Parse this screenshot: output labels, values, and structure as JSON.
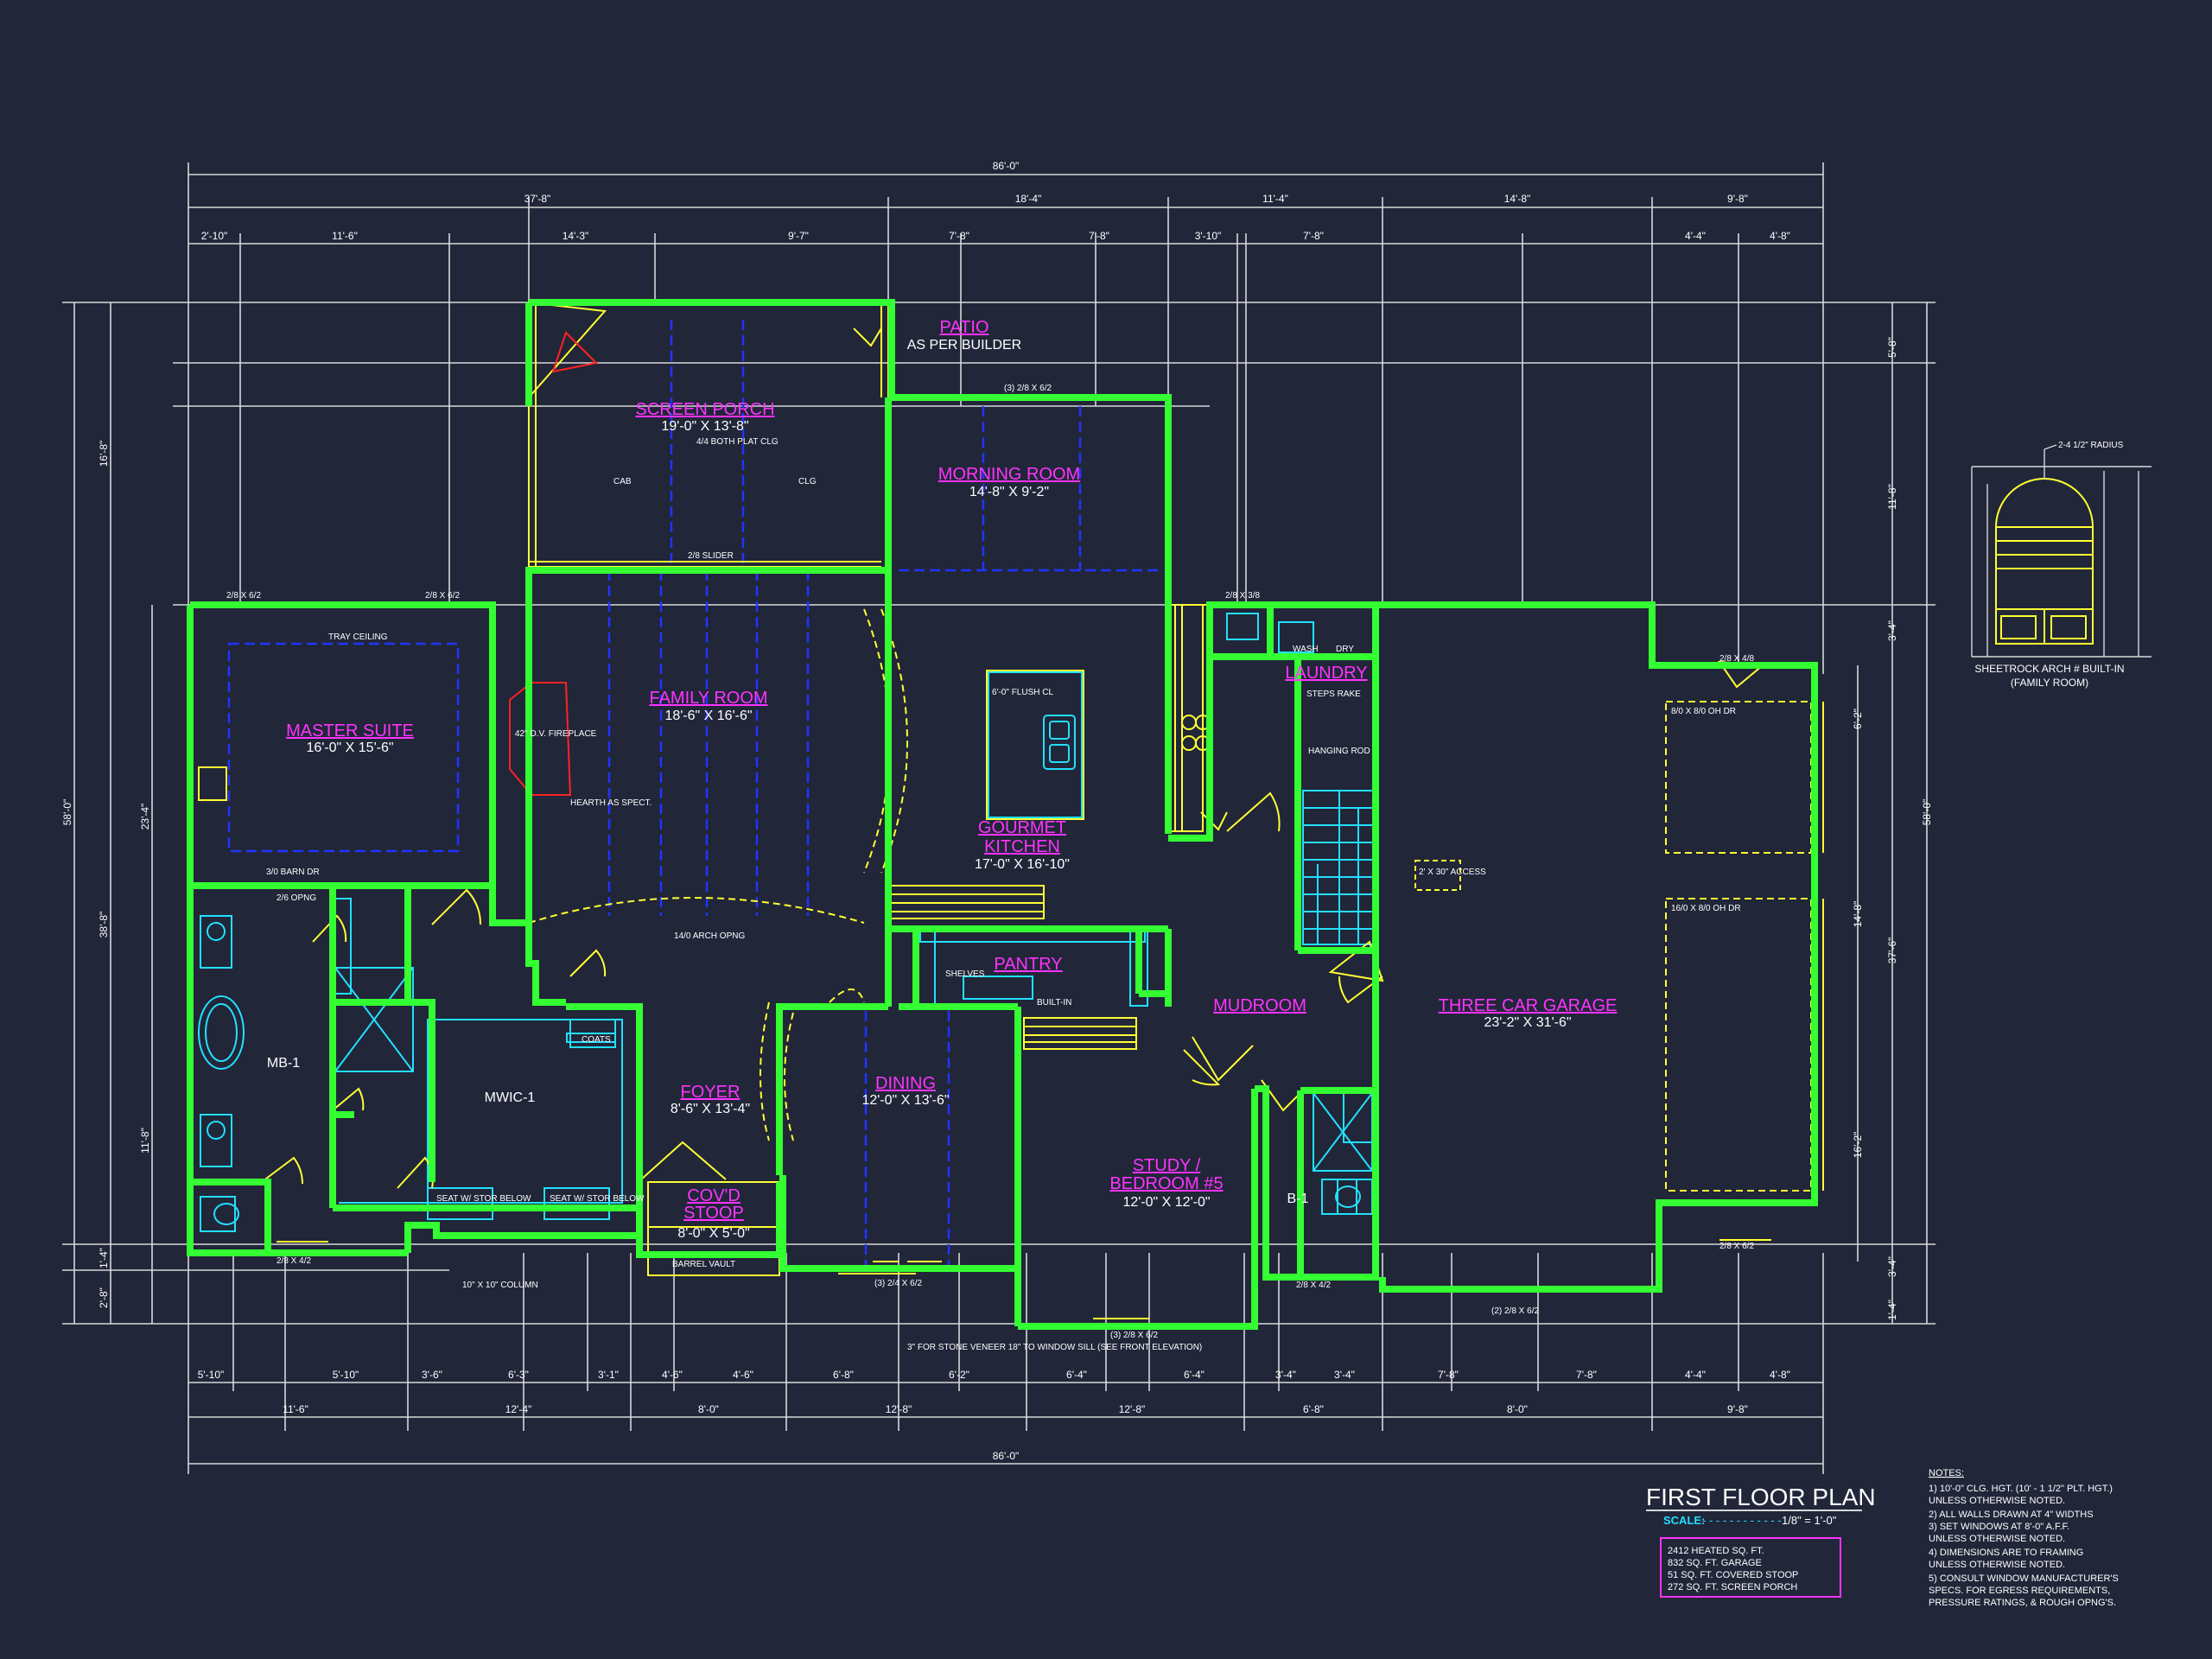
{
  "colors": {
    "background": "#212639",
    "wall": "#33ff33",
    "dimension": "#e8e8e8",
    "room_label": "#ff33ff",
    "fixture": "#ffff33",
    "beam": "#2233ff",
    "cabinet": "#22e0ff",
    "stair": "#22e0ff"
  },
  "rooms": [
    {
      "name": "PATIO",
      "size": "AS PER BUILDER"
    },
    {
      "name": "SCREEN PORCH",
      "size": "19'-0\" X 13'-8\""
    },
    {
      "name": "MORNING ROOM",
      "size": "14'-8\" X 9'-2\""
    },
    {
      "name": "MASTER SUITE",
      "size": "16'-0\" X 15'-6\""
    },
    {
      "name": "FAMILY ROOM",
      "size": "18'-6\" X 16'-6\""
    },
    {
      "name": "GOURMET",
      "size": "KITCHEN"
    },
    {
      "name": "LAUNDRY",
      "size": ""
    },
    {
      "name": "PANTRY",
      "size": ""
    },
    {
      "name": "MUDROOM",
      "size": ""
    },
    {
      "name": "THREE CAR GARAGE",
      "size": "23'-2\" X 31'-6\""
    },
    {
      "name": "FOYER",
      "size": "8'-6\" X 13'-4\""
    },
    {
      "name": "DINING",
      "size": "12'-0\" X 13'-6\""
    },
    {
      "name": "COV'D",
      "size": "STOOP"
    },
    {
      "name": "STUDY /",
      "size": "BEDROOM #5"
    }
  ],
  "room_extra": {
    "kitchen_size": "17'-0\" X 16'-10\"",
    "study_size": "12'-0\" X 12'-0\"",
    "stoop_size": "8'-0\" X 5'-0\""
  },
  "spaces": {
    "mb1": "MB-1",
    "mwic1": "MWIC-1",
    "b1": "B-1"
  },
  "annotations": {
    "tray_ceiling": "TRAY CEILING",
    "fireplace": "42\" D.V. FIREPLACE",
    "hearth": "HEARTH AS SPECT.",
    "barn_dr": "3/0 BARN DR",
    "opng": "2/6 OPNG",
    "seat_stor_1": "SEAT W/ STOR BELOW",
    "seat_stor_2": "SEAT W/ STOR BELOW",
    "coats": "COATS",
    "shelves": "SHELVES",
    "built_in": "BUILT-IN",
    "steps_rake": "STEPS RAKE",
    "hanging_rod": "HANGING ROD",
    "wash": "WASH",
    "dry": "DRY",
    "access": "2' X 30\" ACCESS",
    "barrel_vault": "BARREL VAULT",
    "column": "10\" X 10\" COLUMN",
    "stone_veneer": "3\" FOR STONE VENEER 18\" TO WINDOW SILL (SEE FRONT ELEVATION)",
    "flush_ceil": "6'-0\" FLUSH CL",
    "arch_opng": "14/0 ARCH OPNG",
    "slider": "2/8 SLIDER",
    "ch_dr_1": "8/0 X 8/0 OH DR",
    "ch_dr_2": "16/0 X 8/0 OH DR",
    "radius": "2-4 1/2\" RADIUS",
    "plat_clg": "4/4 BOTH PLAT CLG",
    "cab": "CAB",
    "clg": "CLG"
  },
  "dimensions_top": {
    "overall": "86'-0\"",
    "row2": [
      "37'-8\"",
      "18'-4\"",
      "11'-4\"",
      "14'-8\"",
      "9'-8\""
    ],
    "row3": [
      "2'-10\"",
      "11'-6\"",
      "14'-3\"",
      "9'-7\"",
      "7'-8\"",
      "7'-8\"",
      "3'-10\"",
      "7'-8\"",
      "4'-4\"",
      "4'-8\""
    ]
  },
  "dimensions_bottom": {
    "overall": "86'-0\"",
    "row2": [
      "11'-6\"",
      "12'-4\"",
      "8'-0\"",
      "12'-8\"",
      "12'-8\"",
      "6'-8\"",
      "8'-0\"",
      "9'-8\""
    ],
    "row1": [
      "5'-10\"",
      "5'-10\"",
      "3'-6\"",
      "6'-3\"",
      "3'-1\"",
      "4'-6\"",
      "4'-6\"",
      "6'-8\"",
      "6'-2\"",
      "6'-4\"",
      "6'-4\"",
      "3'-4\"",
      "3'-4\"",
      "7'-8\"",
      "7'-8\"",
      "4'-4\"",
      "4'-8\""
    ]
  },
  "dimensions_left": [
    "58'-0\"",
    "16'-8\"",
    "23'-4\"",
    "38'-8\"",
    "11'-8\"",
    "1'-4\"",
    "2'-8\""
  ],
  "dimensions_right": [
    "5'-8\"",
    "11'-8\"",
    "3'-4\"",
    "58'-0\"",
    "37'-6\"",
    "6'-2\"",
    "14'-8\"",
    "16'-2\"",
    "3'-4\"",
    "1'-4\""
  ],
  "window_labels": [
    "2/8 X 6/2",
    "2/8 X 6/2",
    "(3) 2/8 X 6/2",
    "2/8 X 3/8",
    "2/8 X 4/2",
    "(3) 2/4 X 6/2",
    "(3) 2/8 X 6/2",
    "2/8 X 4/2",
    "(2) 2/8 X 6/2",
    "2/8 X 6/2",
    "2/8 X 4/8"
  ],
  "inset": {
    "caption_1": "SHEETROCK ARCH # BUILT-IN",
    "caption_2": "(FAMILY ROOM)"
  },
  "title_block": {
    "title": "FIRST FLOOR PLAN",
    "scale_label": "SCALE:",
    "scale_value": "1/8\" = 1'-0\"",
    "areas": [
      "2412 HEATED SQ. FT.",
      "832 SQ. FT. GARAGE",
      "51 SQ. FT. COVERED STOOP",
      "272 SQ. FT. SCREEN PORCH"
    ]
  },
  "notes": {
    "heading": "NOTES:",
    "lines": [
      "1)  10'-0\" CLG. HGT. (10' - 1 1/2\" PLT. HGT.)",
      "     UNLESS OTHERWISE NOTED.",
      "2)  ALL WALLS DRAWN AT 4\" WIDTHS",
      "3)  SET WINDOWS AT 8'-0\" A.F.F.",
      "     UNLESS OTHERWISE NOTED.",
      "4)  DIMENSIONS ARE TO FRAMING",
      "     UNLESS OTHERWISE NOTED.",
      "5)  CONSULT WINDOW MANUFACTURER'S",
      "     SPECS. FOR EGRESS REQUIREMENTS,",
      "     PRESSURE RATINGS, & ROUGH OPNG'S."
    ]
  }
}
